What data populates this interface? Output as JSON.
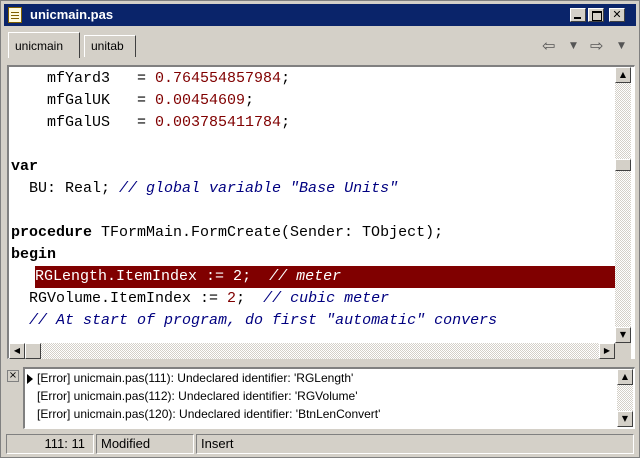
{
  "window": {
    "title": "unicmain.pas",
    "icon": "pascal-file-icon"
  },
  "tabs": [
    {
      "label": "unicmain",
      "active": true
    },
    {
      "label": "unitab",
      "active": false
    }
  ],
  "nav": {
    "back_glyph": "⇦",
    "forward_glyph": "⇨",
    "dropdown_glyph": "▼"
  },
  "code_lines": [
    {
      "parts": [
        {
          "t": "    mfYard3   = "
        },
        {
          "t": "0.764554857984",
          "c": "num"
        },
        {
          "t": ";"
        }
      ]
    },
    {
      "parts": [
        {
          "t": "    mfGalUK   = "
        },
        {
          "t": "0.00454609",
          "c": "num"
        },
        {
          "t": ";"
        }
      ]
    },
    {
      "parts": [
        {
          "t": "    mfGalUS   = "
        },
        {
          "t": "0.003785411784",
          "c": "num"
        },
        {
          "t": ";"
        }
      ]
    },
    {
      "parts": [
        {
          "t": ""
        }
      ]
    },
    {
      "parts": [
        {
          "t": "var",
          "c": "kw"
        }
      ]
    },
    {
      "parts": [
        {
          "t": "  BU: Real; "
        },
        {
          "t": "// global variable \"Base Units\"",
          "c": "cm"
        }
      ]
    },
    {
      "parts": [
        {
          "t": ""
        }
      ]
    },
    {
      "parts": [
        {
          "t": "procedure",
          "c": "kw"
        },
        {
          "t": " TFormMain.FormCreate(Sender: TObject);"
        }
      ]
    },
    {
      "parts": [
        {
          "t": "begin",
          "c": "kw"
        }
      ]
    },
    {
      "error": true,
      "parts": [
        {
          "t": "RGLength.ItemIndex := "
        },
        {
          "t": "2",
          "c": "num"
        },
        {
          "t": ";  "
        },
        {
          "t": "// meter",
          "c": "cm"
        }
      ]
    },
    {
      "parts": [
        {
          "t": "  RGVolume.ItemIndex := "
        },
        {
          "t": "2",
          "c": "num"
        },
        {
          "t": ";  "
        },
        {
          "t": "// cubic meter",
          "c": "cm"
        }
      ]
    },
    {
      "parts": [
        {
          "t": "  "
        },
        {
          "t": "// At start of program, do first \"automatic\" convers",
          "c": "cm"
        }
      ]
    }
  ],
  "messages": [
    "[Error] unicmain.pas(111): Undeclared identifier: 'RGLength'",
    "[Error] unicmain.pas(112): Undeclared identifier: 'RGVolume'",
    "[Error] unicmain.pas(120): Undeclared identifier: 'BtnLenConvert'"
  ],
  "status": {
    "position": "111:  11",
    "modified": "Modified",
    "mode": "Insert"
  },
  "colors": {
    "titlebar": "#0a246a",
    "error_line": "#800000",
    "number": "#800000",
    "comment": "#000080"
  }
}
